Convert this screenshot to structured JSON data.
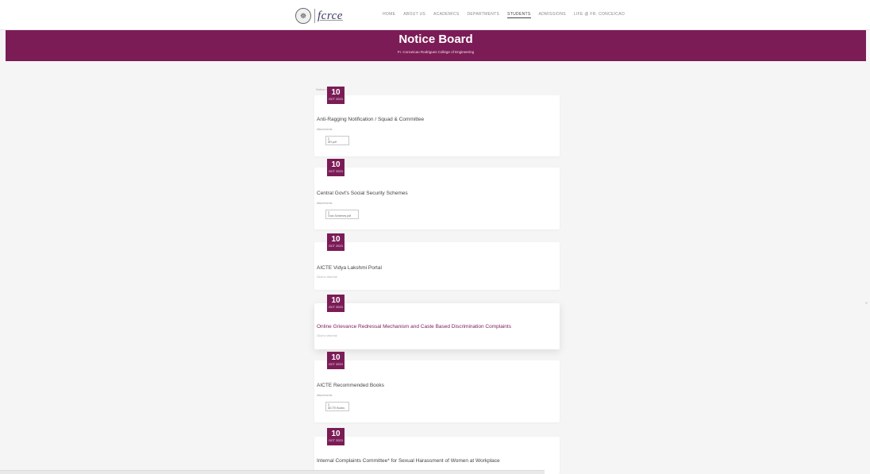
{
  "header": {
    "seal_glyph": "☸",
    "logo_text": "fcrce",
    "nav": [
      "Home",
      "About Us",
      "Academics",
      "Departments",
      "Students",
      "Admissions",
      "Life @ Fr. Conceicao"
    ],
    "active_nav_index": 4
  },
  "hero": {
    "title": "Notice Board",
    "subtitle": "Fr. Conceicao Rodrigues College of Engineering"
  },
  "breadcrumb": "Notice board",
  "notices": [
    {
      "day": "10",
      "month": "OCT 2023",
      "title": "Anti-Ragging Notification / Squad & Committee",
      "attachments_label": "Attachments",
      "attachment": "AR.pdf"
    },
    {
      "day": "10",
      "month": "OCT 2023",
      "title": "Central Govt's Social Security Schemes",
      "attachments_label": "Attachments",
      "attachment": "Govt-Schemes.pdf"
    },
    {
      "day": "10",
      "month": "OCT 2023",
      "title": "AICTE Vidya Lakshmi Portal",
      "no_attachment": "Click to view link"
    },
    {
      "day": "10",
      "month": "OCT 2023",
      "title": "Online Grievance Redressal Mechanism and Caste Based Discrimination Complaints",
      "no_attachment": "Click to view link"
    },
    {
      "day": "10",
      "month": "OCT 2023",
      "title": "AICTE Recommended Books",
      "attachments_label": "Attachments",
      "attachment": "AICTE Books"
    },
    {
      "day": "10",
      "month": "OCT 2023",
      "title": "Internal Complaints Committee* for Sexual Harassment of Women at Workplace"
    }
  ],
  "colors": {
    "brand": "#7b1c56",
    "background": "#f5f5f5"
  }
}
